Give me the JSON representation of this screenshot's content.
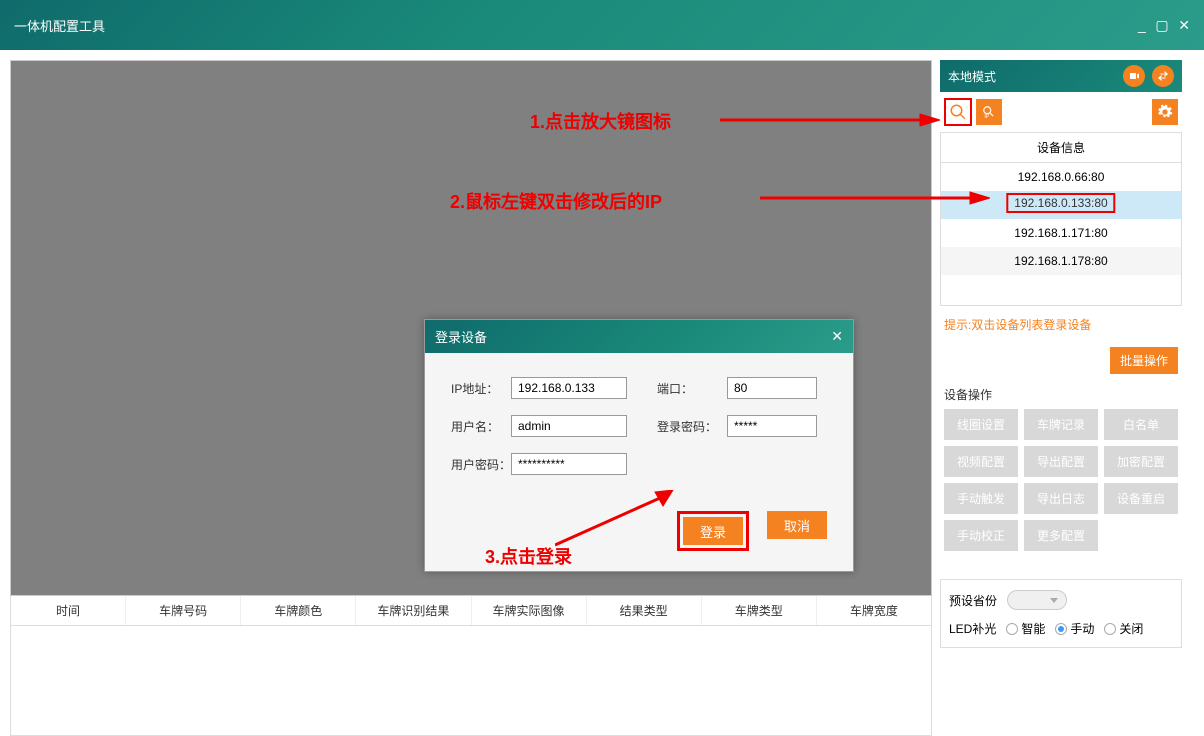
{
  "title": "一体机配置工具",
  "mode": "本地模式",
  "device_info_header": "设备信息",
  "devices": [
    {
      "addr": "192.168.0.66:80",
      "selected": false
    },
    {
      "addr": "192.168.0.133:80",
      "selected": true
    },
    {
      "addr": "192.168.1.171:80",
      "selected": false
    },
    {
      "addr": "192.168.1.178:80",
      "selected": false
    }
  ],
  "hint": "提示:双击设备列表登录设备",
  "batch_btn": "批量操作",
  "section_ops_title": "设备操作",
  "ops": [
    "线圈设置",
    "车牌记录",
    "白名单",
    "视频配置",
    "导出配置",
    "加密配置",
    "手动触发",
    "导出日志",
    "设备重启",
    "手动校正",
    "更多配置"
  ],
  "preset_label": "预设省份",
  "led_label": "LED补光",
  "led_options": {
    "smart": "智能",
    "manual": "手动",
    "off": "关闭"
  },
  "led_selected": "manual",
  "table_cols": [
    "时间",
    "车牌号码",
    "车牌颜色",
    "车牌识别结果",
    "车牌实际图像",
    "结果类型",
    "车牌类型",
    "车牌宽度"
  ],
  "dialog": {
    "title": "登录设备",
    "ip_label": "IP地址：",
    "ip_value": "192.168.0.133",
    "port_label": "端口：",
    "port_value": "80",
    "user_label": "用户名：",
    "user_value": "admin",
    "loginpwd_label": "登录密码：",
    "loginpwd_value": "*****",
    "userpwd_label": "用户密码：",
    "userpwd_value": "**********",
    "login_btn": "登录",
    "cancel_btn": "取消"
  },
  "annotations": {
    "a1": "1.点击放大镜图标",
    "a2": "2.鼠标左键双击修改后的IP",
    "a3": "3.点击登录"
  }
}
